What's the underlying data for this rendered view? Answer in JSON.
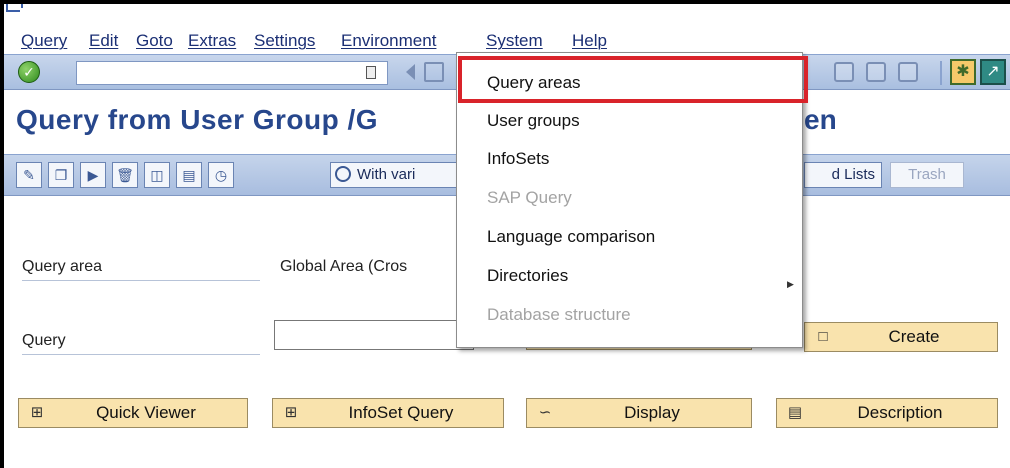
{
  "menubar": {
    "items": [
      "Query",
      "Edit",
      "Goto",
      "Extras",
      "Settings",
      "Environment",
      "System",
      "Help"
    ]
  },
  "page": {
    "title": "Query from User Group /G",
    "title_tail": "en"
  },
  "app_toolbar": {
    "variant_label": "With vari",
    "lists_label": "d Lists",
    "trash_label": "Trash"
  },
  "form": {
    "query_area_label": "Query area",
    "query_area_value": "Global Area (Cros",
    "query_label": "Query",
    "query_value": ""
  },
  "buttons": {
    "create": "Create",
    "quick_viewer": "Quick Viewer",
    "infoset_query": "InfoSet Query",
    "display": "Display",
    "description": "Description"
  },
  "dropdown": {
    "items": [
      {
        "label": "Query areas",
        "enabled": true
      },
      {
        "label": "User groups",
        "enabled": true
      },
      {
        "label": "InfoSets",
        "enabled": true
      },
      {
        "label": "SAP Query",
        "enabled": false
      },
      {
        "label": "Language comparison",
        "enabled": true
      },
      {
        "label": "Directories",
        "enabled": true,
        "submenu": true
      },
      {
        "label": "Database structure",
        "enabled": false
      }
    ],
    "highlighted": "Query areas",
    "highlight_color": "#d9232a"
  },
  "colors": {
    "title": "#27478c",
    "toolbar": "#b4c7e5",
    "action_button": "#f9e3ad"
  }
}
